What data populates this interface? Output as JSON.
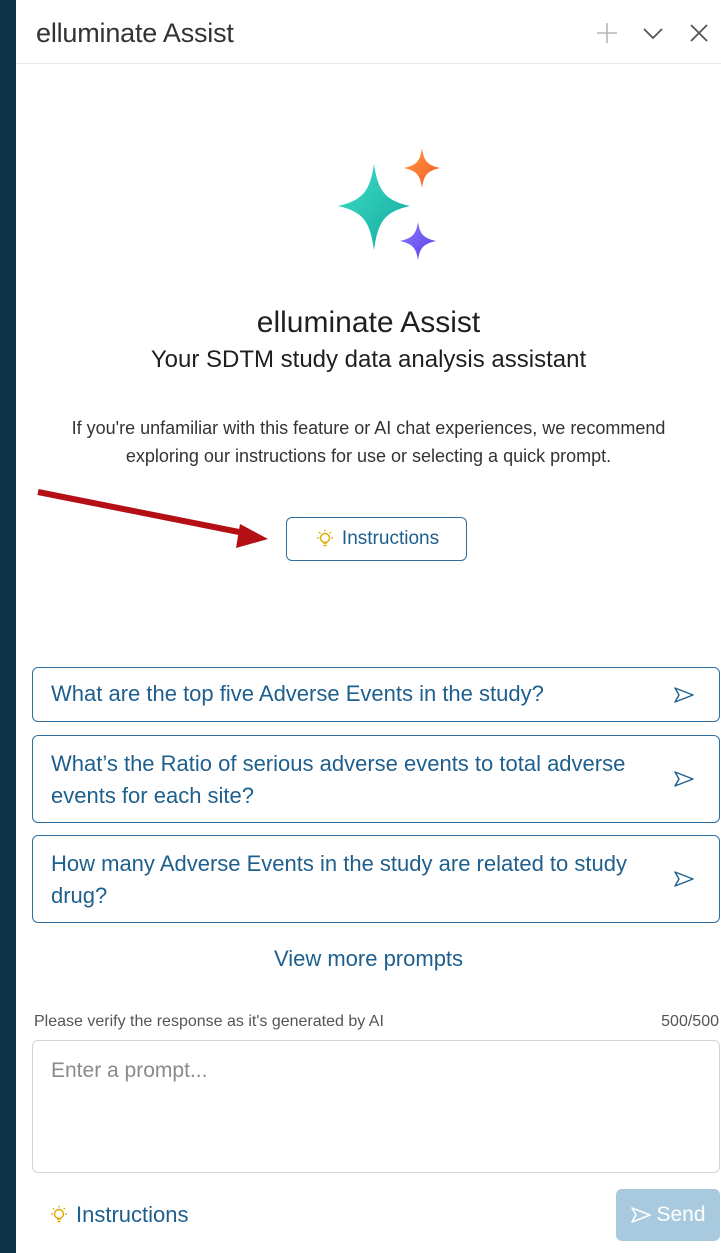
{
  "header": {
    "title": "elluminate Assist",
    "icons": [
      "plus-icon",
      "chevron-down-icon",
      "close-icon"
    ]
  },
  "hero": {
    "title": "elluminate Assist",
    "subtitle": "Your SDTM study data analysis assistant",
    "description": "If you're unfamiliar with this feature or AI chat experiences, we recommend exploring our instructions for use or selecting a quick prompt.",
    "instructions_label": "Instructions"
  },
  "prompts": [
    {
      "text": "What are the top five Adverse Events in the study?"
    },
    {
      "text": "What’s the Ratio of serious adverse events to total adverse events for each site?"
    },
    {
      "text": "How many Adverse Events in the study are related to study drug?"
    }
  ],
  "view_more": "View more prompts",
  "composer": {
    "verify_note": "Please verify the response as it's generated by AI",
    "counter": "500/500",
    "placeholder": "Enter a prompt...",
    "instructions_label": "Instructions",
    "send_label": "Send"
  },
  "colors": {
    "accent": "#1e5f8e",
    "border": "#2e6fa0",
    "send_disabled": "#a9c9de",
    "background": "#0e3347",
    "annotation_arrow": "#b30f14"
  }
}
